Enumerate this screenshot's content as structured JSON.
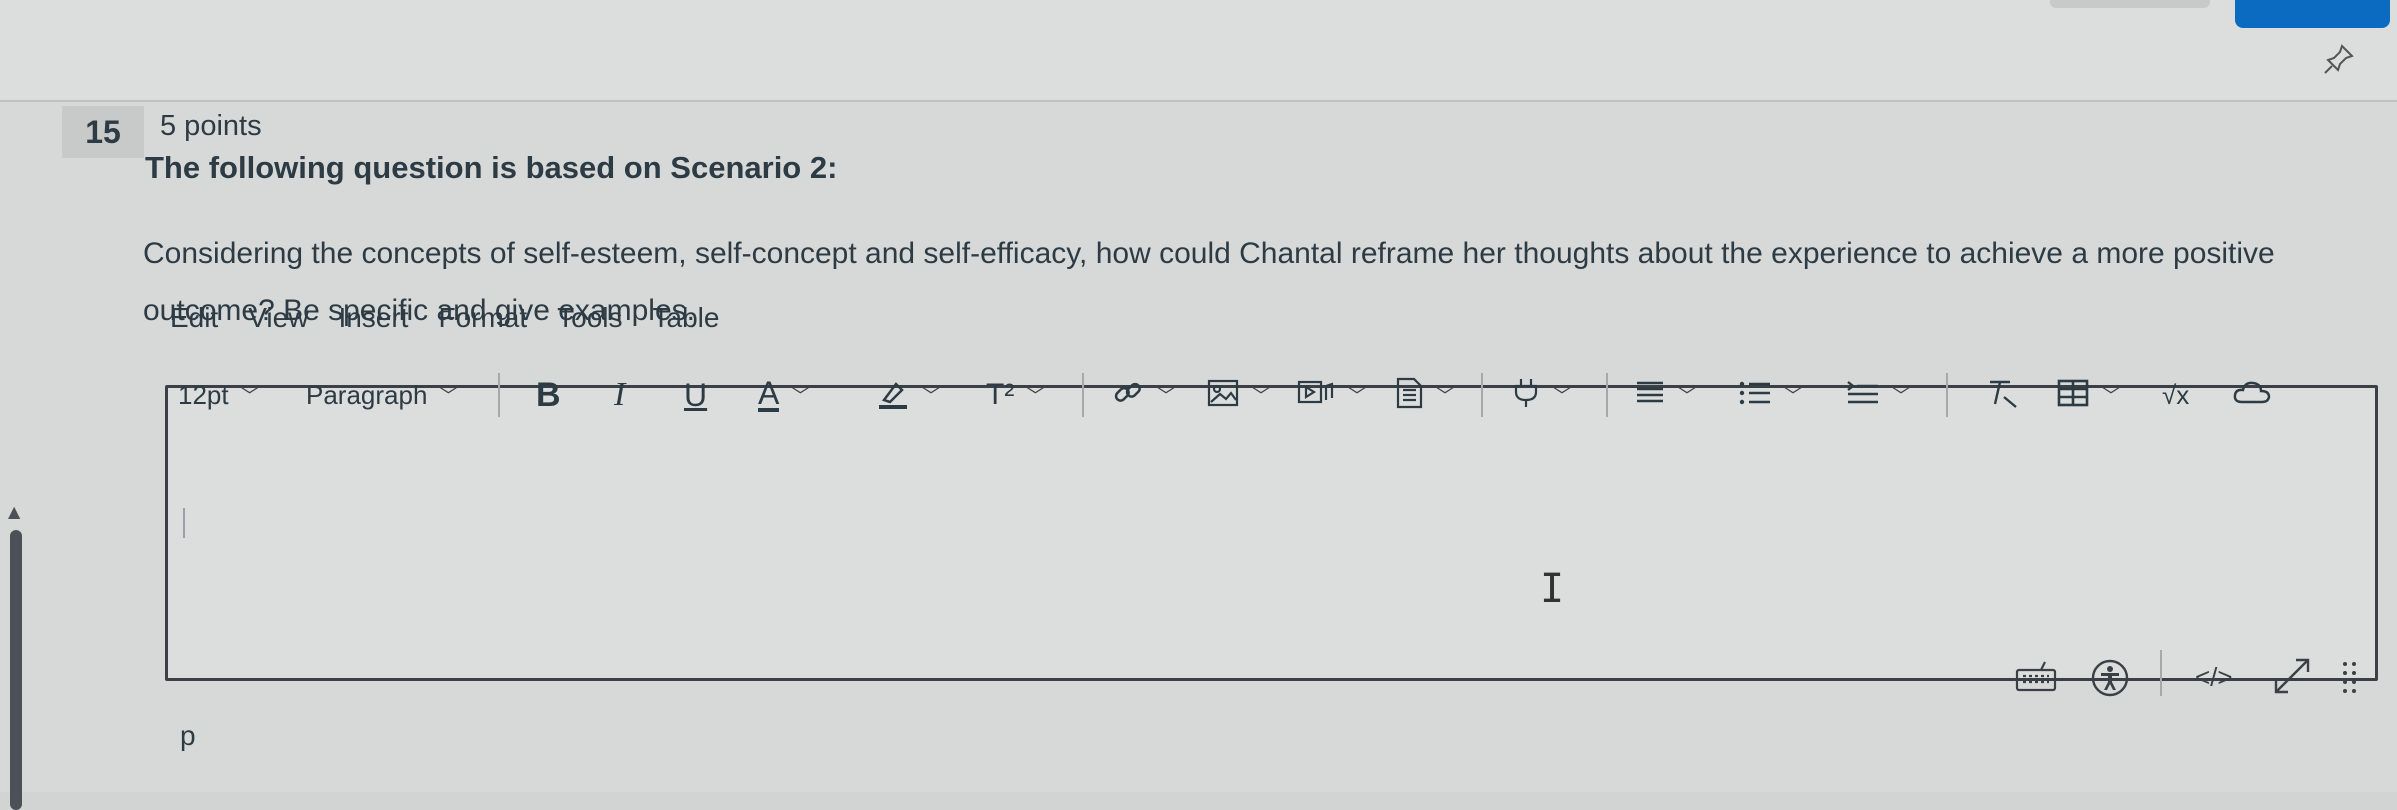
{
  "question": {
    "number": "15",
    "points": "5 points",
    "title": "The following question is based on Scenario 2:",
    "body": "Considering the concepts of self-esteem, self-concept and self-efficacy, how could Chantal reframe her thoughts about the experience to achieve a more positive outcome? Be specific and give examples."
  },
  "menubar": [
    "Edit",
    "View",
    "Insert",
    "Format",
    "Tools",
    "Table"
  ],
  "toolbar": {
    "font_size": "12pt",
    "block_format": "Paragraph",
    "bold": "B",
    "italic": "I",
    "underline": "U",
    "text_color": "A",
    "superscript": "T²",
    "math": "√x"
  },
  "statusbar": {
    "element_path": "p",
    "html_editor": "</>"
  },
  "icons": {
    "pin": "pin-icon",
    "link": "link-icon",
    "image": "image-icon",
    "media": "media-icon",
    "document": "document-icon",
    "plugin": "plugin-icon",
    "align": "align-icon",
    "list": "bullet-list-icon",
    "indent": "indent-icon",
    "clear_format": "clear-format-icon",
    "table": "table-icon",
    "cloud": "cloud-icon",
    "keyboard": "keyboard-icon",
    "accessibility": "accessibility-icon",
    "fullscreen": "fullscreen-icon",
    "resize": "resize-handle-icon"
  },
  "colors": {
    "accent": "#0b6bc1",
    "text": "#2d3b45",
    "editor_border": "#3a4045"
  }
}
